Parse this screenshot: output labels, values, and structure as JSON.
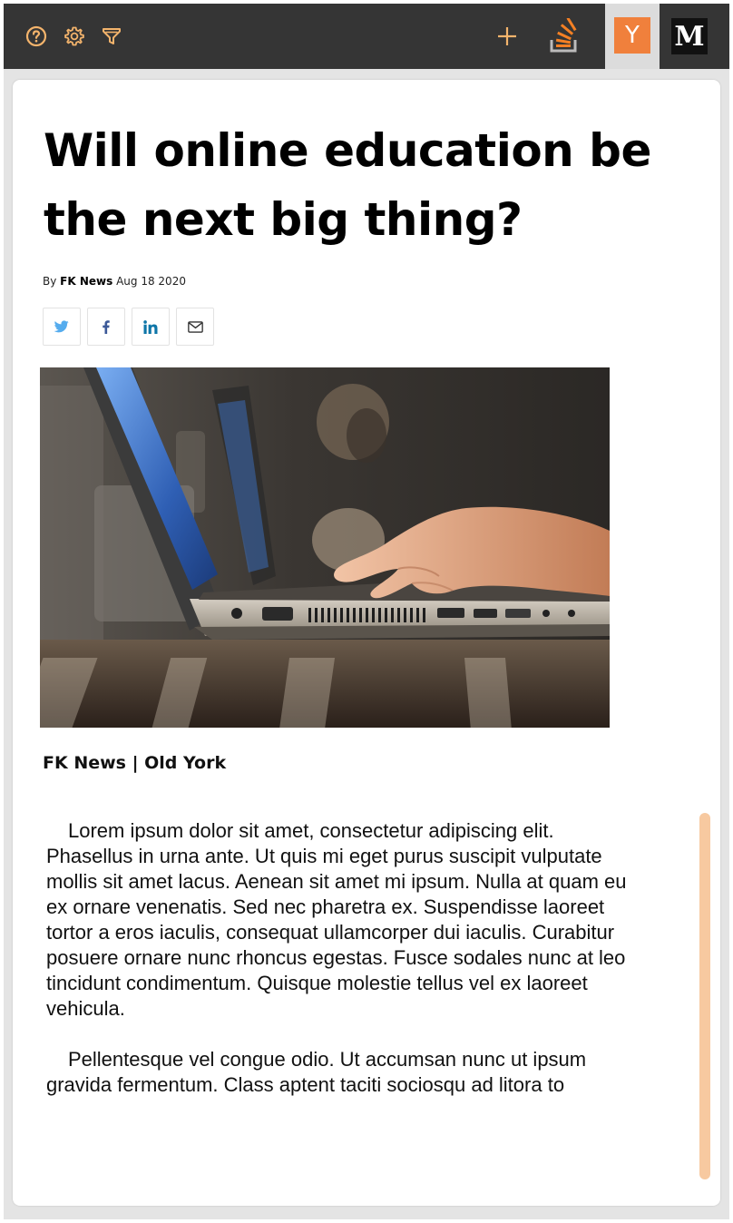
{
  "toolbar": {
    "left_icons": [
      "help-icon",
      "settings-icon",
      "filter-icon"
    ],
    "right_icons": [
      "plus-icon",
      "stackoverflow-icon"
    ],
    "tabs": [
      {
        "label": "Y",
        "active": true,
        "color": "#f0803c"
      },
      {
        "label": "M",
        "active": false,
        "color": "#111111"
      }
    ],
    "icon_color": "#f4b46c"
  },
  "article": {
    "title": "Will online education be the next big thing?",
    "byline": {
      "prefix": "By",
      "author": "FK News",
      "date": "Aug 18 2020"
    },
    "share": [
      {
        "icon": "twitter-icon",
        "color": "#55acee"
      },
      {
        "icon": "facebook-icon",
        "color": "#3b5998"
      },
      {
        "icon": "linkedin-icon",
        "color": "#0e76a8"
      },
      {
        "icon": "email-icon",
        "color": "#333333"
      }
    ],
    "image_alt": "hands typing on a laptop",
    "dateline": "FK News | Old York",
    "paragraphs": [
      "Lorem ipsum dolor sit amet, consectetur adipiscing elit. Phasellus in urna ante. Ut quis mi eget purus suscipit vulputate mollis sit amet lacus. Aenean sit amet mi ipsum. Nulla at quam eu ex ornare venenatis. Sed nec pharetra ex. Suspendisse laoreet tortor a eros iaculis, consequat ullamcorper dui iaculis. Curabitur posuere ornare nunc rhoncus egestas. Fusce sodales nunc at leo tincidunt condimentum. Quisque molestie tellus vel ex laoreet vehicula.",
      "Pellentesque vel congue odio. Ut accumsan nunc ut ipsum gravida fermentum. Class aptent taciti sociosqu ad litora to"
    ]
  },
  "scrollbar": {
    "color": "#f7c9a0"
  }
}
